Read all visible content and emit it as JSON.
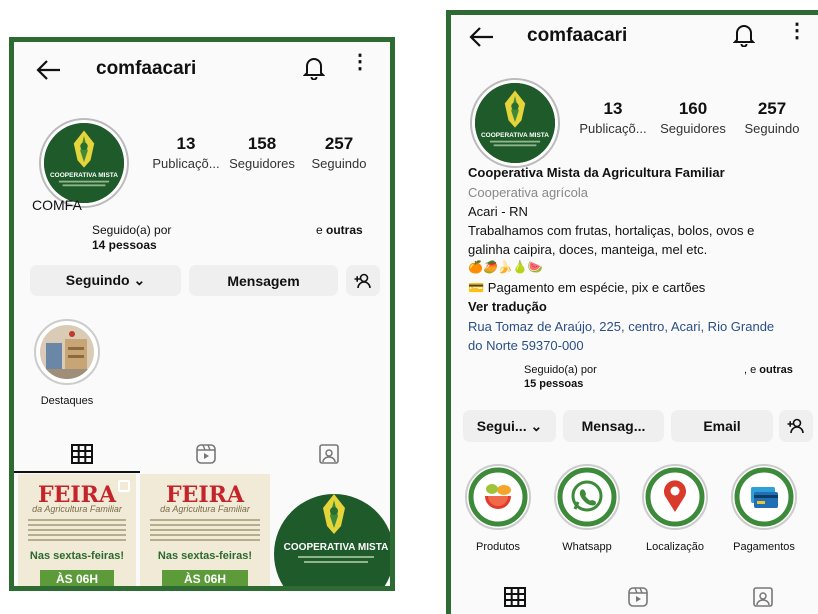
{
  "left": {
    "username": "comfaacari",
    "logo_text": "COOPERATIVA MISTA",
    "stats": [
      {
        "value": "13",
        "label": "Publicaçõ..."
      },
      {
        "value": "158",
        "label": "Seguidores"
      },
      {
        "value": "257",
        "label": "Seguindo"
      }
    ],
    "profile_name": "COMFA",
    "followed_by_label": "Seguido(a) por",
    "followed_by_count": "14 pessoas",
    "and_others_prefix": "e ",
    "and_others": "outras",
    "buttons": {
      "following": "Seguindo ⌄",
      "message": "Mensagem"
    },
    "highlight_label": "Destaques",
    "posts": [
      {
        "title": "FEIRA",
        "subtitle": "da Agricultura Familiar",
        "day": "Nas sextas-feiras!",
        "time": "ÀS 06H"
      },
      {
        "title": "FEIRA",
        "subtitle": "da Agricultura Familiar",
        "day": "Nas sextas-feiras!",
        "time": "ÀS 06H"
      },
      {
        "logo_text": "COOPERATIVA MISTA"
      }
    ]
  },
  "right": {
    "username": "comfaacari",
    "logo_text": "COOPERATIVA MISTA",
    "stats": [
      {
        "value": "13",
        "label": "Publicaçõ..."
      },
      {
        "value": "160",
        "label": "Seguidores"
      },
      {
        "value": "257",
        "label": "Seguindo"
      }
    ],
    "bio": {
      "name": "Cooperativa Mista da Agricultura Familiar",
      "category": "Cooperativa agrícola",
      "location": "Acari - RN",
      "line1": "Trabalhamos com frutas, hortaliças, bolos, ovos e",
      "line2": "galinha caipira, doces, manteiga, mel etc.",
      "emojis": "🍊🥭🍌🍐🍉",
      "payment": "💳 Pagamento em espécie, pix e cartões",
      "translate": "Ver tradução",
      "address1": "Rua Tomaz de Araújo, 225, centro, Acari, Rio Grande",
      "address2": "do Norte 59370-000"
    },
    "followed_by_label": "Seguido(a) por",
    "followed_by_count": "15 pessoas",
    "and_others_prefix": ", e ",
    "and_others": "outras",
    "buttons": {
      "following": "Segui... ⌄",
      "message": "Mensag...",
      "email": "Email"
    },
    "highlights": [
      {
        "label": "Produtos",
        "icon": "fruits-icon"
      },
      {
        "label": "Whatsapp",
        "icon": "whatsapp-icon"
      },
      {
        "label": "Localização",
        "icon": "location-pin-icon"
      },
      {
        "label": "Pagamentos",
        "icon": "credit-card-icon"
      }
    ]
  },
  "colors": {
    "brand_green": "#2e6b32",
    "button_bg": "#efefef",
    "link": "#2a4f86"
  }
}
